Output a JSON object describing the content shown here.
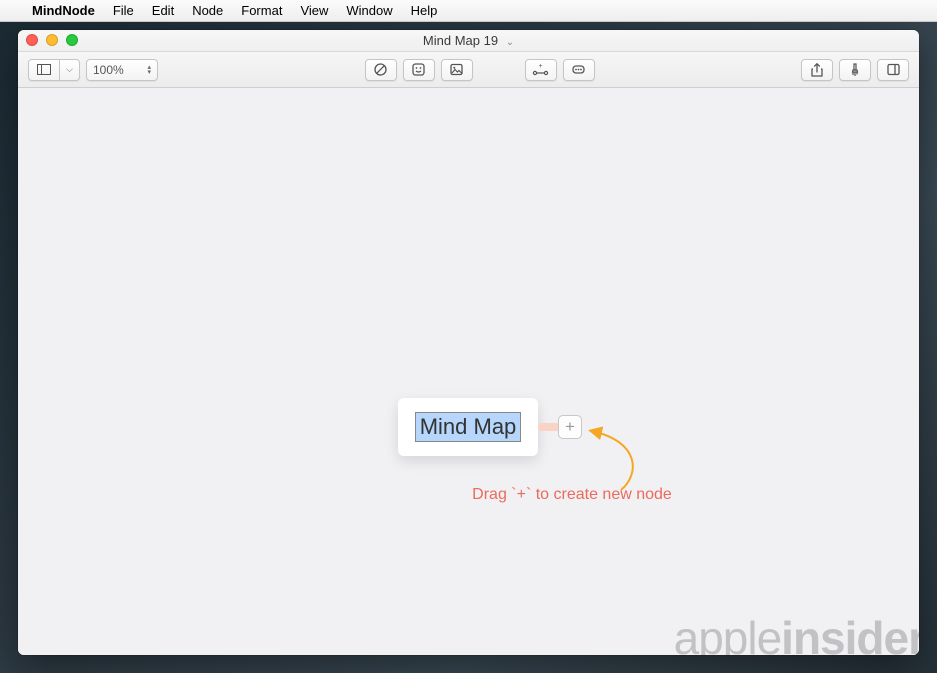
{
  "menubar": {
    "apple_glyph": "",
    "app_name": "MindNode",
    "items": [
      "File",
      "Edit",
      "Node",
      "Format",
      "View",
      "Window",
      "Help"
    ]
  },
  "window": {
    "title": "Mind Map 19"
  },
  "toolbar": {
    "zoom": "100%"
  },
  "canvas": {
    "root_node_text": "Mind Map",
    "add_glyph": "+",
    "hint_text": "Drag `+` to create new node"
  },
  "watermark": {
    "part1": "apple",
    "part2": "insider"
  }
}
